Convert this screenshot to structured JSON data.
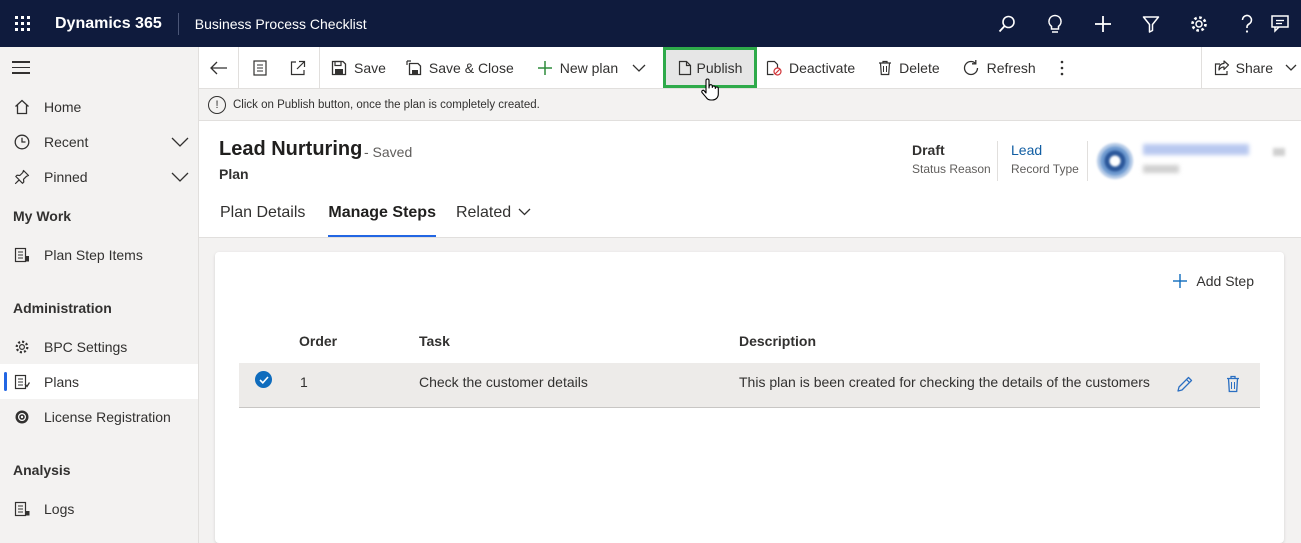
{
  "app": {
    "brand": "Dynamics 365",
    "name": "Business Process Checklist"
  },
  "topbar_icons": [
    "search-icon",
    "lightbulb-icon",
    "add-icon",
    "filter-icon",
    "settings-icon",
    "help-icon",
    "chat-icon"
  ],
  "sidebar": {
    "items": [
      {
        "label": "Home",
        "icon": "home-icon"
      },
      {
        "label": "Recent",
        "icon": "clock-icon"
      },
      {
        "label": "Pinned",
        "icon": "pin-icon"
      }
    ],
    "sections": [
      {
        "title": "My Work",
        "items": [
          {
            "label": "Plan Step Items",
            "icon": "list-icon"
          }
        ]
      },
      {
        "title": "Administration",
        "items": [
          {
            "label": "BPC Settings",
            "icon": "gear-icon"
          },
          {
            "label": "Plans",
            "icon": "plans-icon",
            "active": true
          },
          {
            "label": "License Registration",
            "icon": "license-icon"
          }
        ]
      },
      {
        "title": "Analysis",
        "items": [
          {
            "label": "Logs",
            "icon": "logs-icon"
          }
        ]
      }
    ]
  },
  "commands": {
    "save": "Save",
    "save_close": "Save & Close",
    "new_plan": "New plan",
    "publish": "Publish",
    "deactivate": "Deactivate",
    "delete": "Delete",
    "refresh": "Refresh",
    "share": "Share"
  },
  "notification": "Click on Publish button, once the plan is completely created.",
  "record": {
    "title": "Lead Nurturing",
    "saved_state": "- Saved",
    "entity": "Plan",
    "status_reason_value": "Draft",
    "status_reason_label": "Status Reason",
    "record_type_value": "Lead",
    "record_type_label": "Record Type"
  },
  "tabs": [
    "Plan Details",
    "Manage Steps",
    "Related"
  ],
  "active_tab": "Manage Steps",
  "grid": {
    "add_step": "Add Step",
    "columns": {
      "order": "Order",
      "task": "Task",
      "description": "Description"
    },
    "rows": [
      {
        "order": "1",
        "task": "Check the customer details",
        "description": "This plan is been created for checking the details of the customers",
        "selected": true
      }
    ]
  },
  "colors": {
    "topbar": "#0f1b3d",
    "accent": "#2266e3",
    "highlight_border": "#2eaa4a",
    "check": "#0f6cbd"
  }
}
